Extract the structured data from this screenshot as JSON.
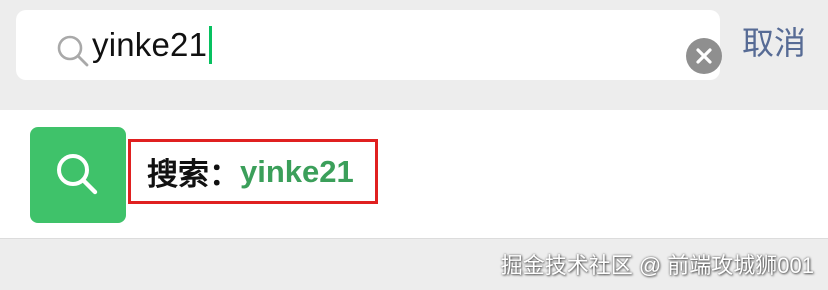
{
  "search": {
    "query": "yinke21",
    "icon": "search-icon",
    "clear_icon": "clear-icon"
  },
  "header": {
    "cancel_label": "取消"
  },
  "result": {
    "icon": "search-icon",
    "prefix": "搜索：",
    "query": "yinke21"
  },
  "watermark": {
    "text": "掘金技术社区 @ 前端攻城狮001"
  },
  "colors": {
    "background": "#ededed",
    "accent_green": "#3fc26a",
    "query_green": "#3b9f5a",
    "link_blue": "#576b95",
    "highlight_red": "#e02020",
    "caret_green": "#07c160"
  }
}
